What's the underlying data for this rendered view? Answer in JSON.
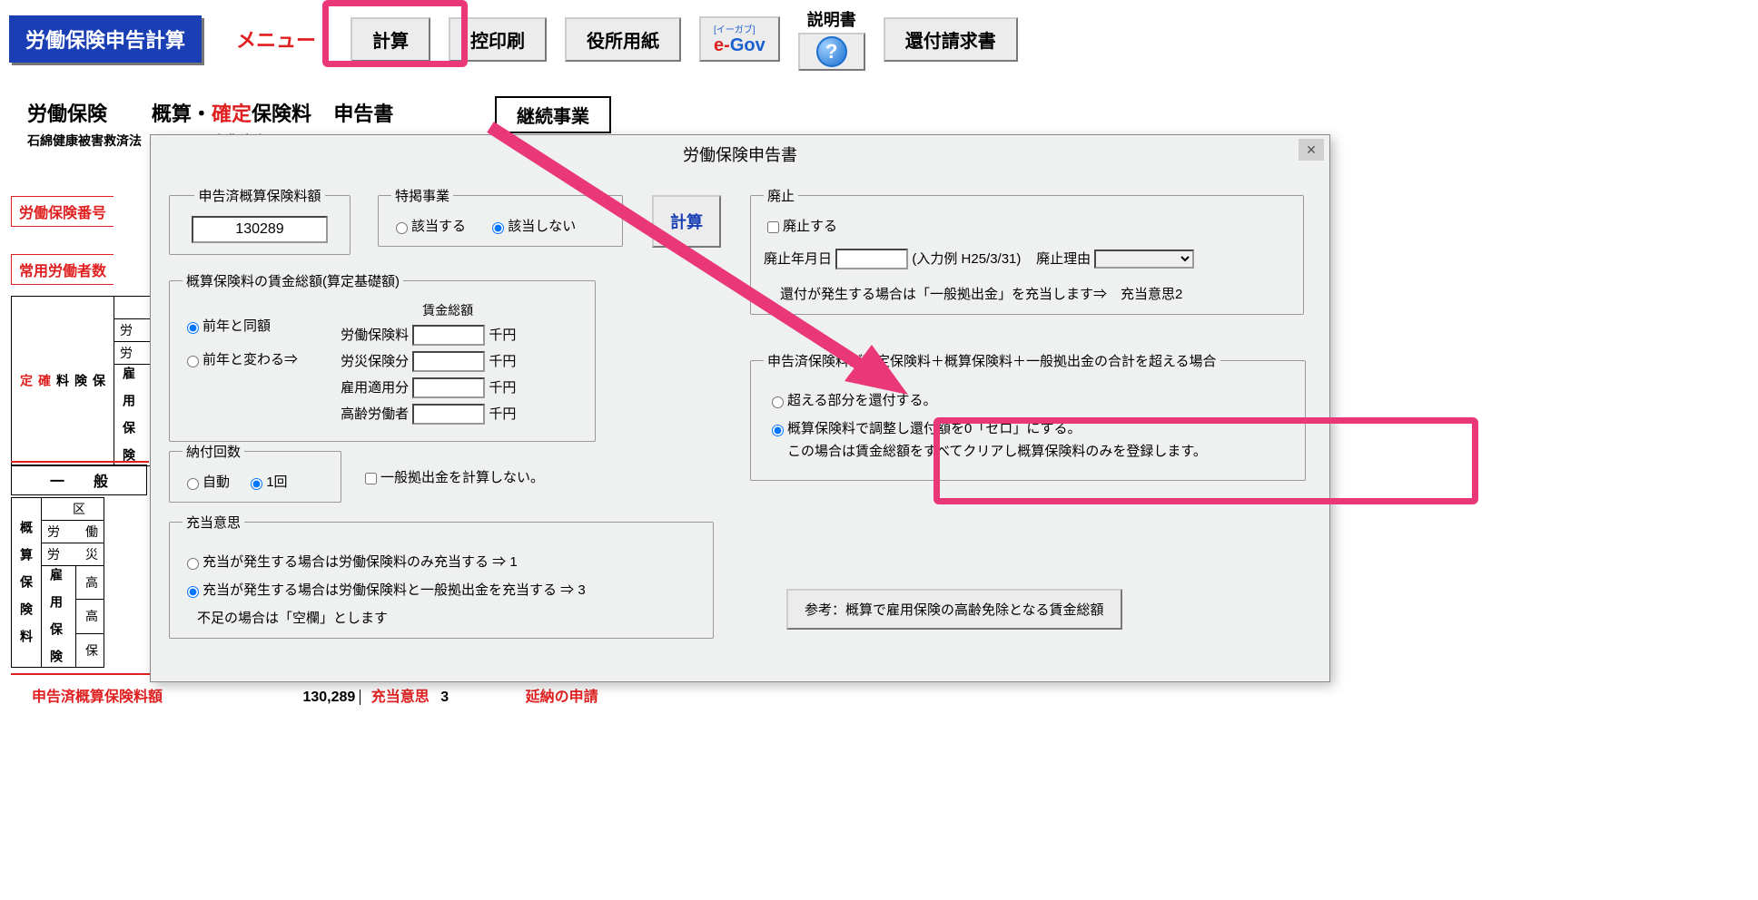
{
  "toolbar": {
    "title": "労働保険申告計算",
    "menu": "メニュー",
    "calc": "計算",
    "print": "控印刷",
    "office_paper": "役所用紙",
    "egov_e": "e-",
    "egov_g": "Gov",
    "egov_sub": "[イーガブ]",
    "help_label": "説明書",
    "help_q": "?",
    "refund_request": "還付請求書"
  },
  "bg": {
    "h1_a": "労働保険",
    "h1_b1": "概算・",
    "h1_b2": "確定",
    "h1_b3": "保険料",
    "h1_c": "申告書",
    "h1_sub_a": "石綿健康被害救済法",
    "h1_sub_b": "一般拠出金",
    "box": "継続事業",
    "lbl_num": "労働保険番号",
    "lbl_workers": "常用労働者数",
    "kubun": "区",
    "rou": "労",
    "sya": "災",
    "ko": "雇",
    "yo_ho_ken": "雇\n用\n保\n険",
    "kakutei": "確\n定\n保\n険\n料",
    "gaisan_v": "概\n算\n保\n険\n料",
    "ippan": "一　　般",
    "foot": "申告済概算保険料額",
    "foot_num": "130,289",
    "foot_c1": "充当意思",
    "foot_c1v": "3",
    "foot_c2": "延納の申請"
  },
  "dlg": {
    "title": "労働保険申告書",
    "close": "✕",
    "declared": {
      "legend": "申告済概算保険料額",
      "value": "130289"
    },
    "special": {
      "legend": "特掲事業",
      "yes": "該当する",
      "no": "該当しない"
    },
    "calc_btn": "計算",
    "gaisan": {
      "legend": "概算保険料の賃金総額(算定基礎額)",
      "same": "前年と同額",
      "diff": "前年と変わる⇒",
      "head": "賃金総額",
      "r1": "労働保険料",
      "r2": "労災保険分",
      "r3": "雇用適用分",
      "r4": "高齢労働者",
      "unit": "千円"
    },
    "noufu": {
      "legend": "納付回数",
      "auto": "自動",
      "one": "1回"
    },
    "ippan_chk": "一般拠出金を計算しない。",
    "juto": {
      "legend": "充当意思",
      "o1": "充当が発生する場合は労働保険料のみ充当する ⇒ 1",
      "o2": "充当が発生する場合は労働保険料と一般拠出金を充当する ⇒ 3",
      "note": "不足の場合は「空欄」とします"
    },
    "haishi": {
      "legend": "廃止",
      "chk": "廃止する",
      "date_lbl": "廃止年月日",
      "date_hint": "(入力例 H25/3/31)",
      "reason_lbl": "廃止理由",
      "note": "還付が発生する場合は「一般拠出金」を充当します⇒　充当意思2"
    },
    "exceed": {
      "legend": "申告済保険料が確定保険料＋概算保険料＋一般拠出金の合計を超える場合",
      "o1": "超える部分を還付する。",
      "o2a": "概算保険料で調整し還付額を0「ゼロ」にする。",
      "o2b": "この場合は賃金総額をすべてクリアし概算保険料のみを登録します。"
    },
    "ref_btn": "参考：概算で雇用保険の高齢免除となる賃金総額"
  }
}
